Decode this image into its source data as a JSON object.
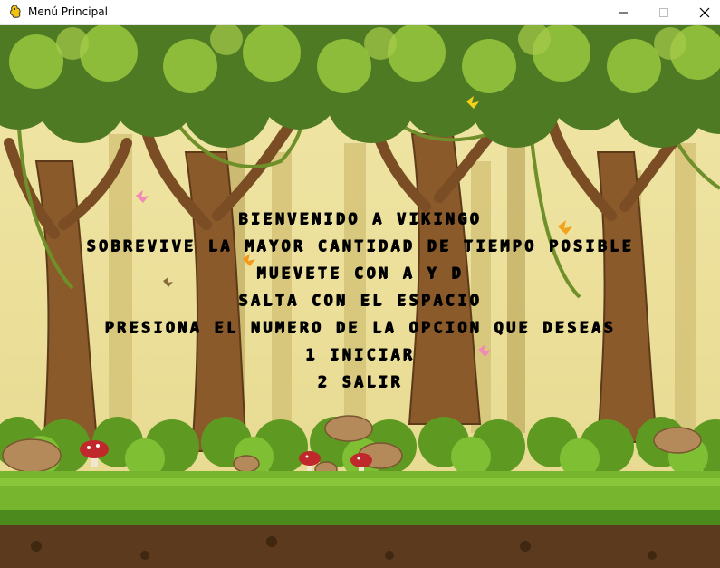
{
  "window": {
    "title": "Menú Principal",
    "controls": {
      "minimize": "—",
      "maximize": "☐",
      "close": "✕"
    },
    "icon": "pygame-snake-icon"
  },
  "menu": {
    "lines": [
      "BIENVENIDO A VIKINGO",
      "SOBREVIVE LA MAYOR CANTIDAD DE TIEMPO POSIBLE",
      "MUEVETE CON A Y D",
      "SALTA CON EL ESPACIO",
      "PRESIONA EL NUMERO DE LA OPCION QUE DESEAS",
      "1 INICIAR",
      "2 SALIR"
    ]
  },
  "colors": {
    "sky": "#e9df9a",
    "canopy_dark": "#4f7a24",
    "canopy_light": "#8dbb3a",
    "trunk": "#8a5a2b",
    "grass": "#78b52e",
    "soil": "#5b3a1e",
    "text": "#000000"
  }
}
